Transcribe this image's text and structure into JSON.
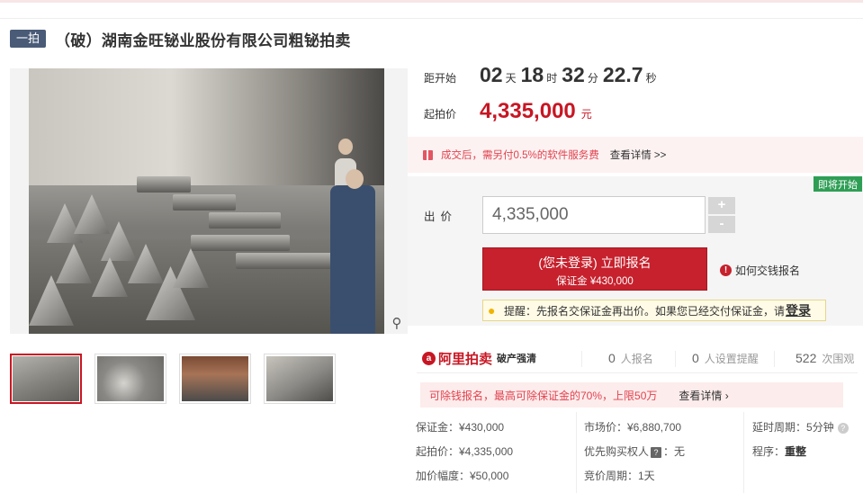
{
  "header": {
    "tag": "一拍",
    "title": "（破）湖南金旺铋业股份有限公司粗铋拍卖"
  },
  "gallery": {
    "thumbnails": [
      "thumb-1",
      "thumb-2",
      "thumb-3",
      "thumb-4"
    ],
    "active_index": 0,
    "zoom_icon": "magnifier-icon"
  },
  "countdown": {
    "label": "距开始",
    "days": "02",
    "days_unit": "天",
    "hours": "18",
    "hours_unit": "时",
    "minutes": "32",
    "minutes_unit": "分",
    "seconds": "22.7",
    "seconds_unit": "秒"
  },
  "start_price": {
    "label": "起拍价",
    "value": "4,335,000",
    "unit": "元"
  },
  "notice": {
    "text": "成交后，需另付0.5%的软件服务费",
    "link": "查看详情 >>"
  },
  "bid": {
    "badge": "即将开始",
    "label": "出价",
    "input_value": "4,335,000",
    "plus": "+",
    "minus": "-",
    "signup_main": "(您未登录) 立即报名",
    "signup_sub": "保证金 ¥430,000",
    "howto": "如何交钱报名",
    "reminder_text": "提醒：先报名交保证金再出价。如果您已经交付保证金，请",
    "reminder_login": "登录"
  },
  "stats": {
    "logo_text": "阿里拍卖",
    "logo_sub": "破产强清",
    "signups_value": "0",
    "signups_label": "人报名",
    "reminders_value": "0",
    "reminders_label": "人设置提醒",
    "views_value": "522",
    "views_label": "次围观"
  },
  "deduct": {
    "text": "可除钱报名，最高可除保证金的70%，上限50万",
    "link": "查看详情 ›"
  },
  "details": {
    "deposit": "保证金：¥430,000",
    "start_price": "起拍价：¥4,335,000",
    "increment": "加价幅度：¥50,000",
    "market_price": "市场价：¥6,880,700",
    "preemptive_label": "优先购买权人",
    "preemptive_value": "：无",
    "cycle": "竞价周期：1天",
    "delay_label": "延时周期：",
    "delay_value": "5分钟",
    "procedure_label": "程序：",
    "procedure_value": "重整"
  },
  "colors": {
    "accent": "#c81623",
    "tag_bg": "#4a5b78",
    "badge_green": "#2e9e55",
    "notice_bg": "#fdf2f2"
  }
}
